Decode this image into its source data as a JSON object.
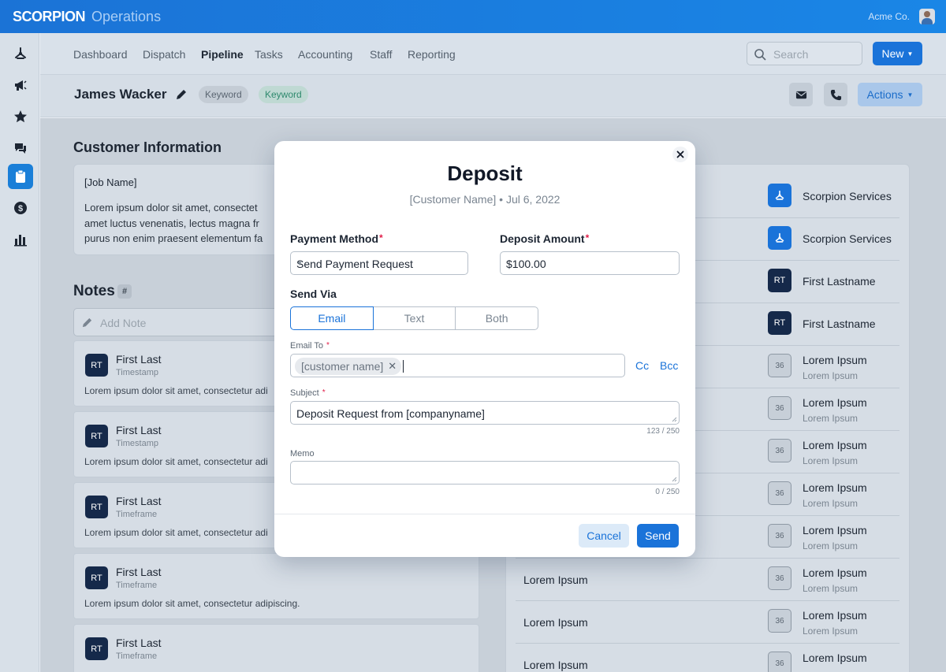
{
  "app": {
    "brand": "SCORPION",
    "brand_sub": "Operations",
    "company": "Acme Co."
  },
  "nav": {
    "items": [
      "Dashboard",
      "Dispatch",
      "Pipeline",
      "Tasks",
      "Accounting",
      "Staff",
      "Reporting"
    ],
    "active": "Pipeline",
    "search_placeholder": "Search",
    "new_label": "New"
  },
  "header": {
    "customer": "James Wacker",
    "chips": [
      "Keyword",
      "Keyword"
    ],
    "actions_label": "Actions"
  },
  "customer_info": {
    "title": "Customer Information",
    "job_name": "[Job Name]",
    "desc_lines": [
      "Lorem ipsum dolor sit amet, consectet",
      "amet luctus venenatis, lectus magna fr",
      "purus non enim praesent elementum fa"
    ]
  },
  "notes": {
    "title": "Notes",
    "hash": "#",
    "add_placeholder": "Add Note",
    "items": [
      {
        "initials": "RT",
        "name": "First Last",
        "sub": "Timestamp",
        "text": "Lorem ipsum dolor sit amet, consectetur adi"
      },
      {
        "initials": "RT",
        "name": "First Last",
        "sub": "Timestamp",
        "text": "Lorem ipsum dolor sit amet, consectetur adi"
      },
      {
        "initials": "RT",
        "name": "First Last",
        "sub": "Timeframe",
        "text": "Lorem ipsum dolor sit amet, consectetur adi"
      },
      {
        "initials": "RT",
        "name": "First Last",
        "sub": "Timeframe",
        "text": "Lorem ipsum dolor sit amet, consectetur adipiscing."
      },
      {
        "initials": "RT",
        "name": "First Last",
        "sub": "Timeframe",
        "text": ""
      }
    ]
  },
  "right_panel": {
    "rows": [
      {
        "left": "",
        "icon": "scorpion",
        "badge": "",
        "title": "Scorpion Services",
        "sub": ""
      },
      {
        "left": "",
        "icon": "scorpion",
        "badge": "",
        "title": "Scorpion Services",
        "sub": ""
      },
      {
        "left": "",
        "icon": "initials",
        "badge": "RT",
        "title": "First Lastname",
        "sub": ""
      },
      {
        "left": "",
        "icon": "initials",
        "badge": "RT",
        "title": "First Lastname",
        "sub": ""
      },
      {
        "left": "",
        "icon": "number",
        "badge": "36",
        "title": "Lorem Ipsum",
        "sub": "Lorem Ipsum"
      },
      {
        "left": "",
        "icon": "number",
        "badge": "36",
        "title": "Lorem Ipsum",
        "sub": "Lorem Ipsum"
      },
      {
        "left": "",
        "icon": "number",
        "badge": "36",
        "title": "Lorem Ipsum",
        "sub": "Lorem Ipsum"
      },
      {
        "left": "",
        "icon": "number",
        "badge": "36",
        "title": "Lorem Ipsum",
        "sub": "Lorem Ipsum"
      },
      {
        "left": "",
        "icon": "number",
        "badge": "36",
        "title": "Lorem Ipsum",
        "sub": "Lorem Ipsum"
      },
      {
        "left": "Lorem Ipsum",
        "icon": "number",
        "badge": "36",
        "title": "Lorem Ipsum",
        "sub": "Lorem Ipsum"
      },
      {
        "left": "Lorem Ipsum",
        "icon": "number",
        "badge": "36",
        "title": "Lorem Ipsum",
        "sub": "Lorem Ipsum"
      },
      {
        "left": "Lorem Ipsum",
        "icon": "number",
        "badge": "36",
        "title": "Lorem Ipsum",
        "sub": ""
      }
    ]
  },
  "modal": {
    "title": "Deposit",
    "subtitle": "[Customer Name] • Jul 6, 2022",
    "payment_method_label": "Payment Method",
    "payment_method_value": "Send Payment Request",
    "deposit_amount_label": "Deposit Amount",
    "deposit_amount_value": "$100.00",
    "send_via_label": "Send Via",
    "send_via_options": [
      "Email",
      "Text",
      "Both"
    ],
    "send_via_selected": "Email",
    "email_to_label": "Email To",
    "email_token": "[customer name]",
    "cc_label": "Cc",
    "bcc_label": "Bcc",
    "subject_label": "Subject",
    "subject_value": "Deposit Request from [companyname]",
    "subject_counter": "123 / 250",
    "memo_label": "Memo",
    "memo_value": "",
    "memo_counter": "0 / 250",
    "cancel_label": "Cancel",
    "send_label": "Send",
    "required_mark": "*"
  },
  "colors": {
    "accent": "#1a73d9",
    "topbar": "#1b73d6",
    "required": "#e11d48",
    "navy_badge": "#15294a"
  },
  "icons": {
    "rail": [
      "scorpion-logo-icon",
      "megaphone-icon",
      "star-icon",
      "chat-icon",
      "clipboard-icon",
      "dollar-icon",
      "bar-chart-icon"
    ],
    "active_rail": "clipboard-icon"
  }
}
